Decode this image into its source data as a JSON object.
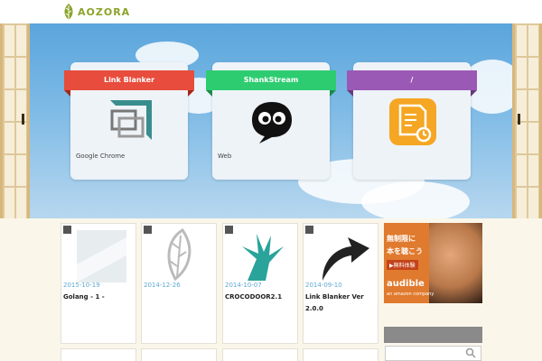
{
  "header": {
    "logo_text": "AOZORA"
  },
  "hero": {
    "cards": [
      {
        "title": "Link Blanker",
        "desc": "Google Chrome",
        "icon": "link-blanker-icon",
        "color": "#e74c3c"
      },
      {
        "title": "ShankStream",
        "desc": "Web",
        "icon": "eyes-speech-icon",
        "color": "#2ecc71"
      },
      {
        "title": "/",
        "desc": "",
        "icon": "notepad-bike-icon",
        "color": "#9b59b6"
      }
    ]
  },
  "posts": [
    {
      "date": "2015-10-19",
      "title": "Golang - 1 -",
      "thumb": "glass-thumb-icon"
    },
    {
      "date": "2014-12-26",
      "title": "",
      "thumb": "leaf-thumb-icon"
    },
    {
      "date": "2014-10-07",
      "title": "CROCODOOR2.1",
      "thumb": "hand-thumb-icon"
    },
    {
      "date": "2014-09-10",
      "title": "Link Blanker Ver 2.0.0",
      "thumb": "arrow-thumb-icon"
    }
  ],
  "ad": {
    "line1": "無制限に",
    "line2": "本を聴こう",
    "button": "▶無料体験",
    "brand": "audible",
    "brand_sub": "an amazon company"
  }
}
